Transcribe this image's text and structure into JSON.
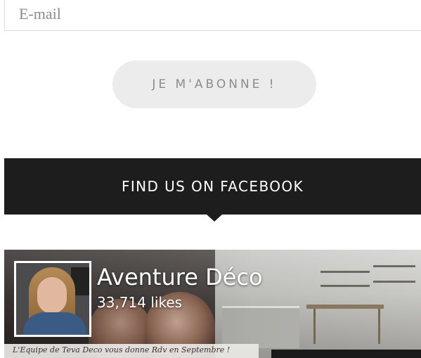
{
  "newsletter": {
    "email_placeholder": "E-mail",
    "subscribe_label": "JE M'ABONNE !"
  },
  "facebook": {
    "section_title": "FIND US ON FACEBOOK",
    "page_name": "Aventure Déco",
    "likes": "33,714 likes",
    "cover_caption": "L'Equipe de Teva Deco vous donne Rdv en Septembre !"
  },
  "colors": {
    "header_bg": "#1d1d1d",
    "button_bg": "#ececec",
    "button_text": "#8c8c8c"
  }
}
